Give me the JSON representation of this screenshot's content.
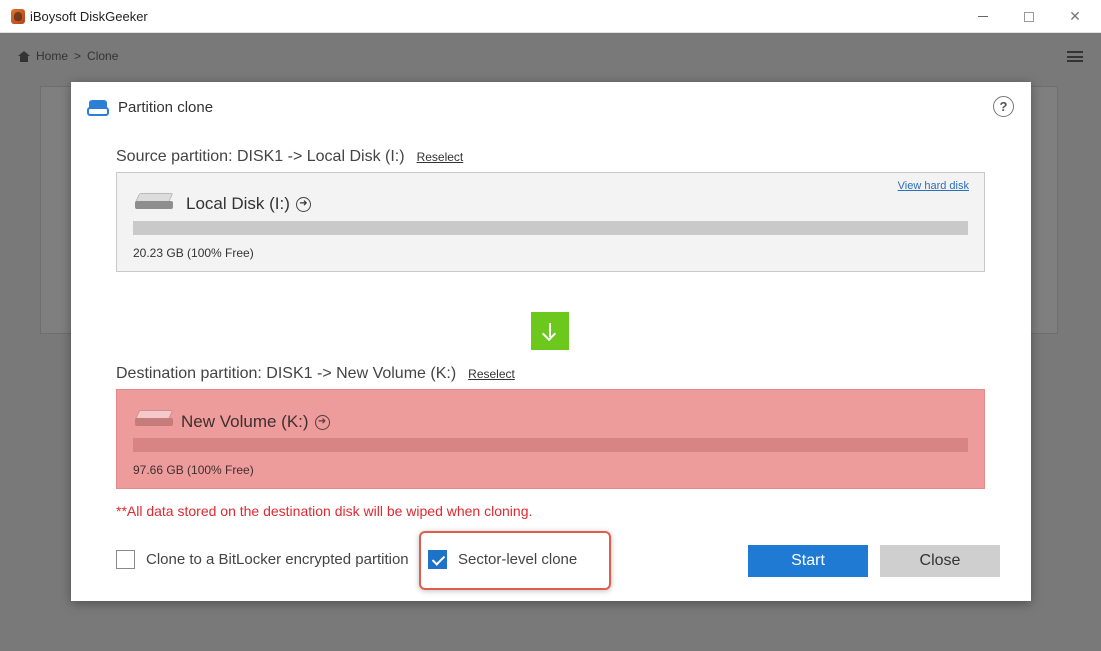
{
  "window": {
    "title": "iBoysoft DiskGeeker",
    "minimize_icon": "minimize-icon",
    "maximize_icon": "maximize-icon",
    "close_symbol": "✕"
  },
  "background_app": {
    "breadcrumb": [
      "Home",
      "Clone"
    ]
  },
  "dialog": {
    "title": "Partition clone",
    "help_symbol": "?",
    "source": {
      "label": "Source partition: DISK1 -> Local Disk (I:)",
      "reselect": "Reselect",
      "view_link": "View hard disk",
      "disk_name": "Local Disk (I:)",
      "size_text": "20.23 GB (100% Free)",
      "free_fraction": 1.0
    },
    "destination": {
      "label": "Destination partition: DISK1 -> New Volume (K:)",
      "reselect": "Reselect",
      "disk_name": "New Volume (K:)",
      "size_text": "97.66 GB (100% Free)",
      "free_fraction": 1.0
    },
    "arrow_icon": "arrow-down-icon",
    "warning": "**All data stored on the destination disk will be wiped when cloning.",
    "options": {
      "bitlocker_label": "Clone to a BitLocker encrypted partition",
      "bitlocker_checked": false,
      "sector_label": "Sector-level clone",
      "sector_checked": true
    },
    "buttons": {
      "start": "Start",
      "close": "Close"
    }
  },
  "colors": {
    "accent": "#1f7ad4",
    "arrow_green": "#6cc81d",
    "destination_red": "#ee9b9b",
    "warning_red": "#e0292f",
    "highlight_border": "#e05d4e"
  }
}
